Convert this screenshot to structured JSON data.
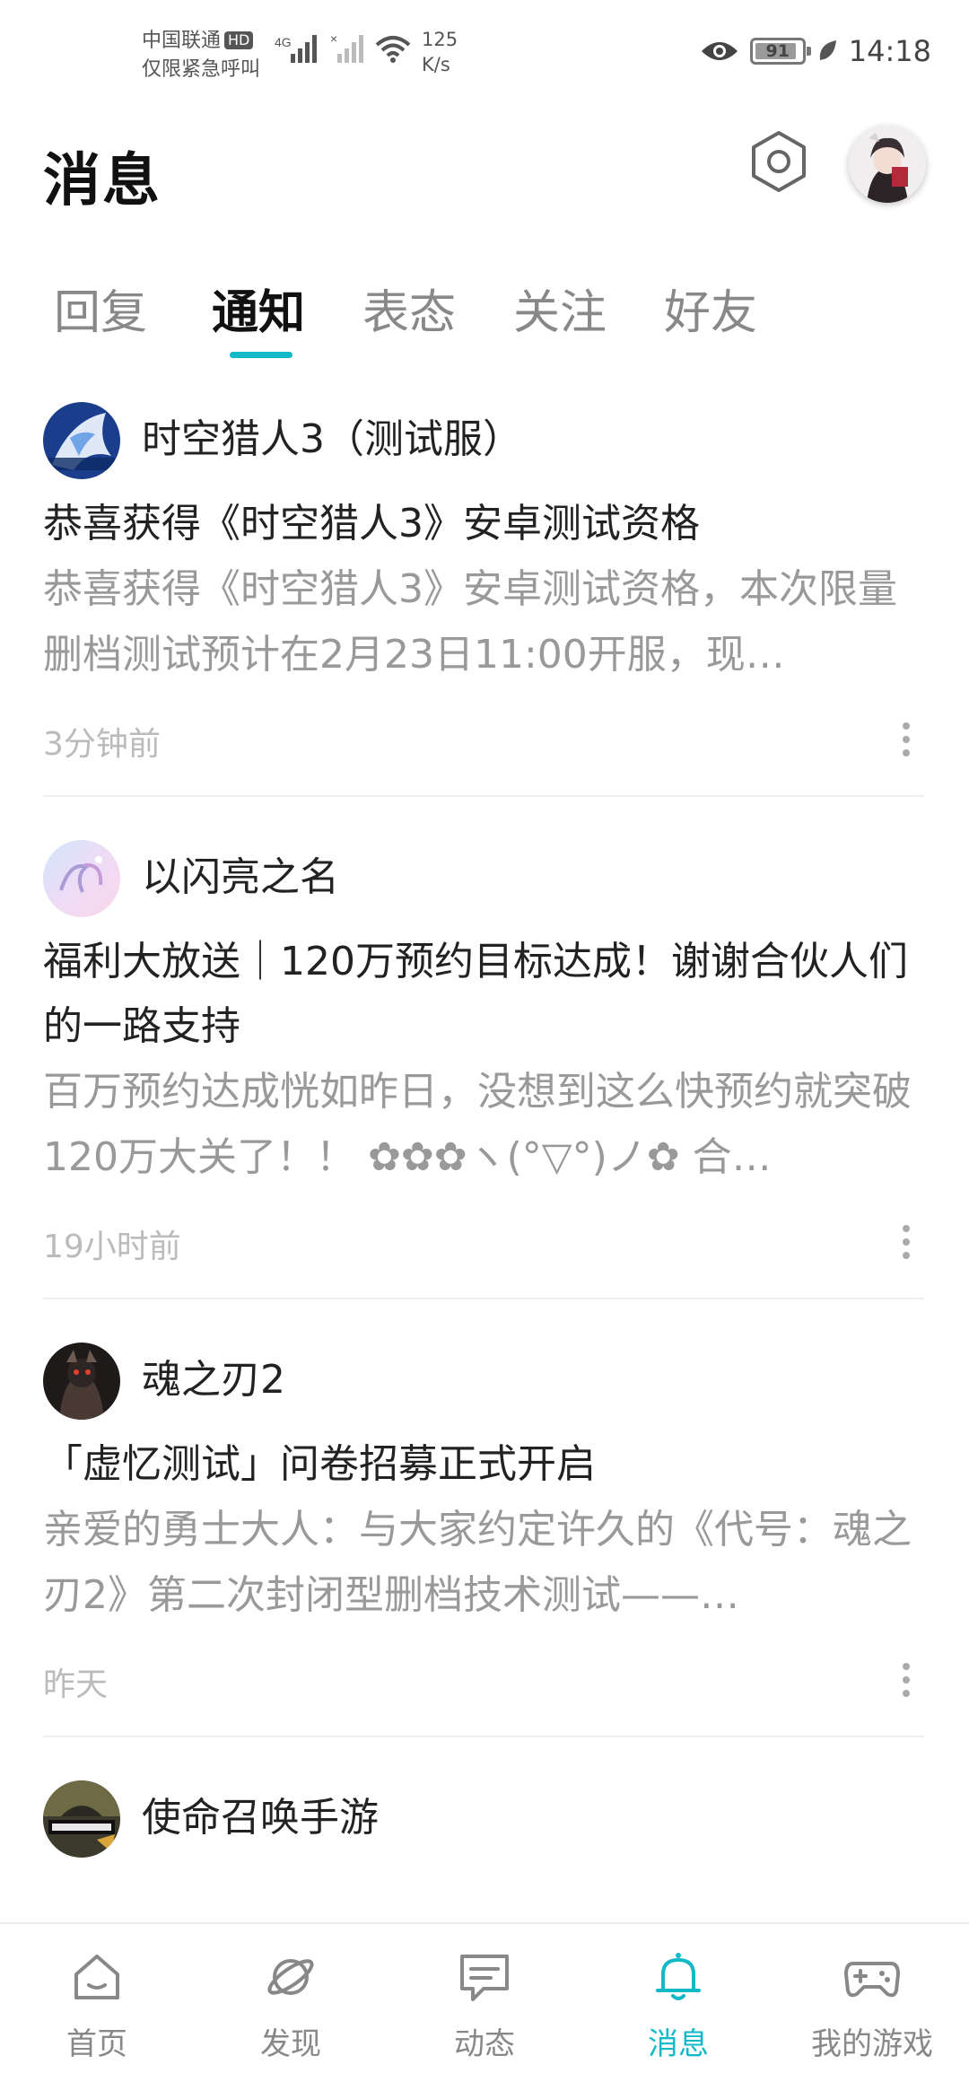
{
  "status_bar": {
    "carrier_line1": "中国联通",
    "hd_badge": "HD",
    "carrier_line2": "仅限紧急呼叫",
    "network_type": "4G",
    "net_speed_value": "125",
    "net_speed_unit": "K/s",
    "battery": "91",
    "battery_level": 0.91,
    "time": "14:18"
  },
  "header": {
    "title": "消息"
  },
  "tabs": [
    {
      "label": "回复",
      "active": false
    },
    {
      "label": "通知",
      "active": true
    },
    {
      "label": "表态",
      "active": false
    },
    {
      "label": "关注",
      "active": false
    },
    {
      "label": "好友",
      "active": false
    }
  ],
  "notifications": [
    {
      "source": "时空猎人3（测试服）",
      "title": "恭喜获得《时空猎人3》安卓测试资格",
      "body": "恭喜获得《时空猎人3》安卓测试资格，本次限量删档测试预计在2月23日11:00开服，现…",
      "time": "3分钟前"
    },
    {
      "source": "以闪亮之名",
      "title": "福利大放送｜120万预约目标达成！谢谢合伙人们的一路支持",
      "body": "百万预约达成恍如昨日，没想到这么快预约就突破120万大关了！！ ✿✿✿ヽ(°▽°)ノ✿ 合…",
      "time": "19小时前"
    },
    {
      "source": "魂之刃2",
      "title": "「虚忆测试」问卷招募正式开启",
      "body": "亲爱的勇士大人：与大家约定许久的《代号：魂之刃2》第二次封闭型删档技术测试——…",
      "time": "昨天"
    },
    {
      "source": "使命召唤手游",
      "title": "",
      "body": "",
      "time": ""
    }
  ],
  "bottom_nav": [
    {
      "label": "首页",
      "icon": "home-icon",
      "active": false
    },
    {
      "label": "发现",
      "icon": "planet-icon",
      "active": false
    },
    {
      "label": "动态",
      "icon": "chat-icon",
      "active": false
    },
    {
      "label": "消息",
      "icon": "bell-icon",
      "active": true
    },
    {
      "label": "我的游戏",
      "icon": "gamepad-icon",
      "active": false
    }
  ],
  "colors": {
    "accent": "#14b9c8",
    "muted_text": "#999999"
  }
}
